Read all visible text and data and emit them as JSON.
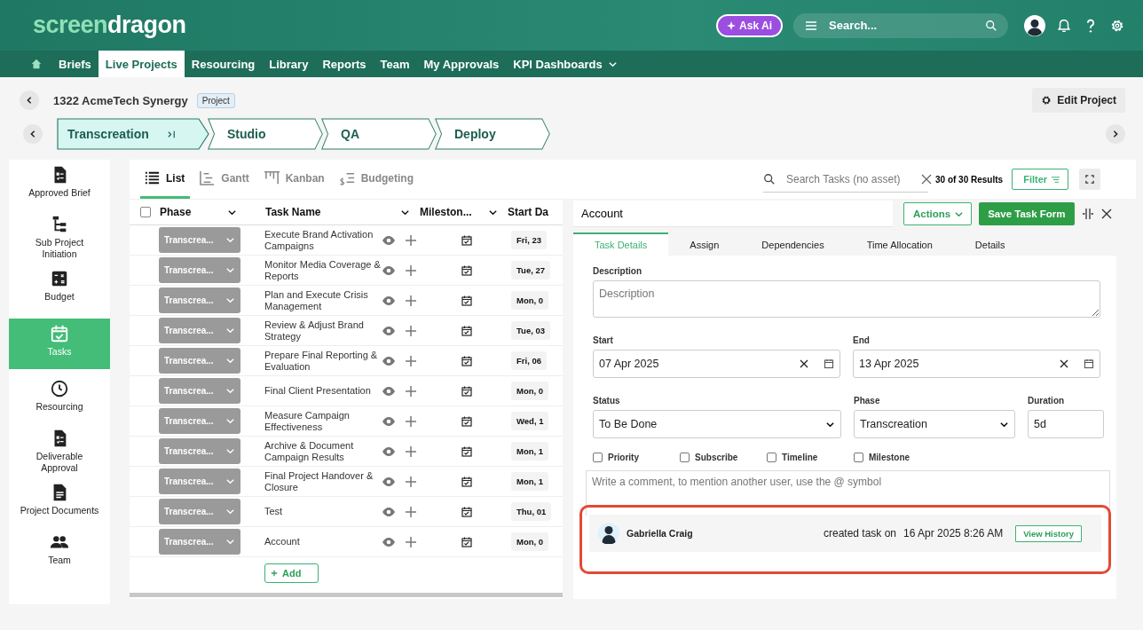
{
  "logo": [
    "screen",
    "dragon"
  ],
  "header": {
    "ask_ai": "Ask Ai",
    "search_placeholder": "Search..."
  },
  "nav": [
    {
      "label": "Briefs",
      "selected": false
    },
    {
      "label": "Live Projects",
      "selected": true
    },
    {
      "label": "Resourcing",
      "selected": false
    },
    {
      "label": "Library",
      "selected": false
    },
    {
      "label": "Reports",
      "selected": false
    },
    {
      "label": "Team",
      "selected": false
    },
    {
      "label": "My Approvals",
      "selected": false
    },
    {
      "label": "KPI Dashboards",
      "selected": false,
      "dropdown": true
    }
  ],
  "project": {
    "title": "1322 AcmeTech Synergy",
    "tag": "Project",
    "edit_button": "Edit Project"
  },
  "stages": [
    {
      "label": "Transcreation",
      "selected": true
    },
    {
      "label": "Studio",
      "selected": false
    },
    {
      "label": "QA",
      "selected": false
    },
    {
      "label": "Deploy",
      "selected": false
    }
  ],
  "sidebar": [
    {
      "label": "Approved Brief",
      "kind": "checklist",
      "selected": false
    },
    {
      "label": "Sub Project Initiation",
      "kind": "hierarchy",
      "selected": false
    },
    {
      "label": "Budget",
      "kind": "calculator",
      "selected": false
    },
    {
      "label": "Tasks",
      "kind": "calendar",
      "selected": true
    },
    {
      "label": "Resourcing",
      "kind": "clock",
      "selected": false
    },
    {
      "label": "Deliverable Approval",
      "kind": "checklist",
      "selected": false
    },
    {
      "label": "Project Documents",
      "kind": "document",
      "selected": false
    },
    {
      "label": "Team",
      "kind": "people",
      "selected": false
    }
  ],
  "views": [
    {
      "label": "List",
      "kind": "list",
      "selected": true
    },
    {
      "label": "Gantt",
      "kind": "gantt",
      "selected": false
    },
    {
      "label": "Kanban",
      "kind": "kanban",
      "selected": false
    },
    {
      "label": "Budgeting",
      "kind": "budget",
      "selected": false
    }
  ],
  "select_all_checked": false,
  "task_search": {
    "placeholder": "Search Tasks (no asset)",
    "results": "30 of 30 Results",
    "filter": "Filter"
  },
  "columns": [
    "Phase",
    "Task Name",
    "Mileston...",
    "Start Da"
  ],
  "rows": [
    {
      "phase": "Transcrea...",
      "name": "Execute Brand Activation Campaigns",
      "start": "Fri, 23"
    },
    {
      "phase": "Transcrea...",
      "name": "Monitor Media Coverage & Reports",
      "start": "Tue, 27"
    },
    {
      "phase": "Transcrea...",
      "name": "Plan and Execute Crisis Management",
      "start": "Mon, 0"
    },
    {
      "phase": "Transcrea...",
      "name": "Review & Adjust Brand Strategy",
      "start": "Tue, 03"
    },
    {
      "phase": "Transcrea...",
      "name": "Prepare Final Reporting & Evaluation",
      "start": "Fri, 06"
    },
    {
      "phase": "Transcrea...",
      "name": "Final Client Presentation",
      "start": "Mon, 0"
    },
    {
      "phase": "Transcrea...",
      "name": "Measure Campaign Effectiveness",
      "start": "Wed, 1"
    },
    {
      "phase": "Transcrea...",
      "name": "Archive & Document Campaign Results",
      "start": "Mon, 1"
    },
    {
      "phase": "Transcrea...",
      "name": "Final Project Handover & Closure",
      "start": "Mon, 1"
    },
    {
      "phase": "Transcrea...",
      "name": "Test",
      "start": "Thu, 01"
    },
    {
      "phase": "Transcrea...",
      "name": "Account",
      "start": "Mon, 0"
    }
  ],
  "add_button": "Add",
  "detail": {
    "title": "Account",
    "actions": "Actions",
    "save": "Save Task Form",
    "tabs": [
      {
        "label": "Task Details",
        "selected": true
      },
      {
        "label": "Assign",
        "selected": false
      },
      {
        "label": "Dependencies",
        "selected": false
      },
      {
        "label": "Time Allocation",
        "selected": false
      },
      {
        "label": "Details",
        "selected": false
      }
    ],
    "description": {
      "label": "Description",
      "placeholder": "Description"
    },
    "start": {
      "label": "Start",
      "value": "07 Apr 2025"
    },
    "end": {
      "label": "End",
      "value": "13 Apr 2025"
    },
    "status": {
      "label": "Status",
      "value": "To Be Done"
    },
    "phase": {
      "label": "Phase",
      "value": "Transcreation"
    },
    "duration": {
      "label": "Duration",
      "value": "5d"
    },
    "checkboxes": [
      {
        "label": "Priority",
        "checked": false
      },
      {
        "label": "Subscribe",
        "checked": false
      },
      {
        "label": "Timeline",
        "checked": false
      },
      {
        "label": "Milestone",
        "checked": false
      }
    ],
    "comment_placeholder": "Write a comment, to mention another user, use the @ symbol",
    "activity": {
      "user": "Gabriella Craig",
      "action": "created task on",
      "date": "16 Apr 2025 8:26 AM",
      "button": "View History",
      "highlighted": true
    }
  }
}
